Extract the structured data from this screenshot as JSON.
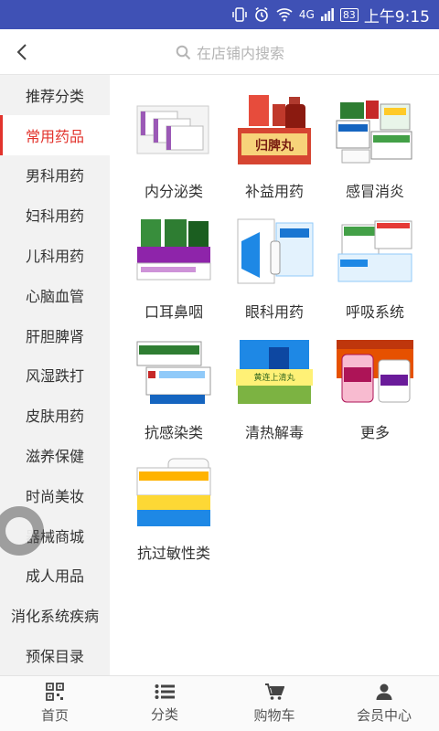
{
  "status_bar": {
    "network": "4G",
    "battery": "83",
    "time": "上午9:15"
  },
  "header": {
    "search_placeholder": "在店铺内搜索"
  },
  "sidebar": {
    "items": [
      {
        "label": "推荐分类"
      },
      {
        "label": "常用药品"
      },
      {
        "label": "男科用药"
      },
      {
        "label": "妇科用药"
      },
      {
        "label": "儿科用药"
      },
      {
        "label": "心脑血管"
      },
      {
        "label": "肝胆脾肾"
      },
      {
        "label": "风湿跌打"
      },
      {
        "label": "皮肤用药"
      },
      {
        "label": "滋养保健"
      },
      {
        "label": "时尚美妆"
      },
      {
        "label": "器械商城"
      },
      {
        "label": "成人用品"
      },
      {
        "label": "消化系统疾病"
      },
      {
        "label": "预保目录"
      }
    ],
    "active_index": 1
  },
  "categories": [
    {
      "label": "内分泌类"
    },
    {
      "label": "补益用药"
    },
    {
      "label": "感冒消炎"
    },
    {
      "label": "口耳鼻咽"
    },
    {
      "label": "眼科用药"
    },
    {
      "label": "呼吸系统"
    },
    {
      "label": "抗感染类"
    },
    {
      "label": "清热解毒"
    },
    {
      "label": "更多"
    },
    {
      "label": "抗过敏性类"
    }
  ],
  "product_text": {
    "bupi": "归脾丸",
    "qingre": "黄连上清丸"
  },
  "tabbar": {
    "items": [
      {
        "label": "首页",
        "icon": "qr-icon"
      },
      {
        "label": "分类",
        "icon": "list-icon"
      },
      {
        "label": "购物车",
        "icon": "cart-icon"
      },
      {
        "label": "会员中心",
        "icon": "user-icon"
      }
    ]
  },
  "colors": {
    "status_bar": "#3f51b5",
    "active": "#e2332c",
    "sidebar_bg": "#f2f2f2"
  }
}
